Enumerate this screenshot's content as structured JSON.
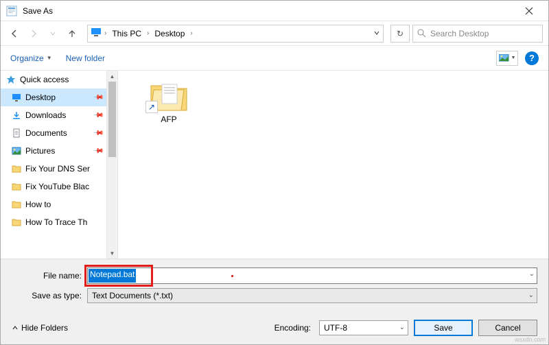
{
  "window": {
    "title": "Save As"
  },
  "nav": {
    "crumb1": "This PC",
    "crumb2": "Desktop",
    "search_placeholder": "Search Desktop",
    "refresh_icon": "↻"
  },
  "toolbar": {
    "organize": "Organize",
    "newfolder": "New folder",
    "help": "?"
  },
  "sidebar": {
    "quick_access": "Quick access",
    "items": [
      {
        "label": "Desktop",
        "pinned": true,
        "selected": true
      },
      {
        "label": "Downloads",
        "pinned": true
      },
      {
        "label": "Documents",
        "pinned": true
      },
      {
        "label": "Pictures",
        "pinned": true
      },
      {
        "label": "Fix Your DNS Ser"
      },
      {
        "label": "Fix YouTube Blac"
      },
      {
        "label": "How to"
      },
      {
        "label": "How To Trace Th"
      }
    ]
  },
  "content": {
    "folder_label": "AFP"
  },
  "form": {
    "filename_label": "File name:",
    "filename_value": "Notepad.bat",
    "type_label": "Save as type:",
    "type_value": "Text Documents (*.txt)"
  },
  "footer": {
    "hide_folders": "Hide Folders",
    "encoding_label": "Encoding:",
    "encoding_value": "UTF-8",
    "save": "Save",
    "cancel": "Cancel"
  },
  "watermark": "wsxdn.com"
}
